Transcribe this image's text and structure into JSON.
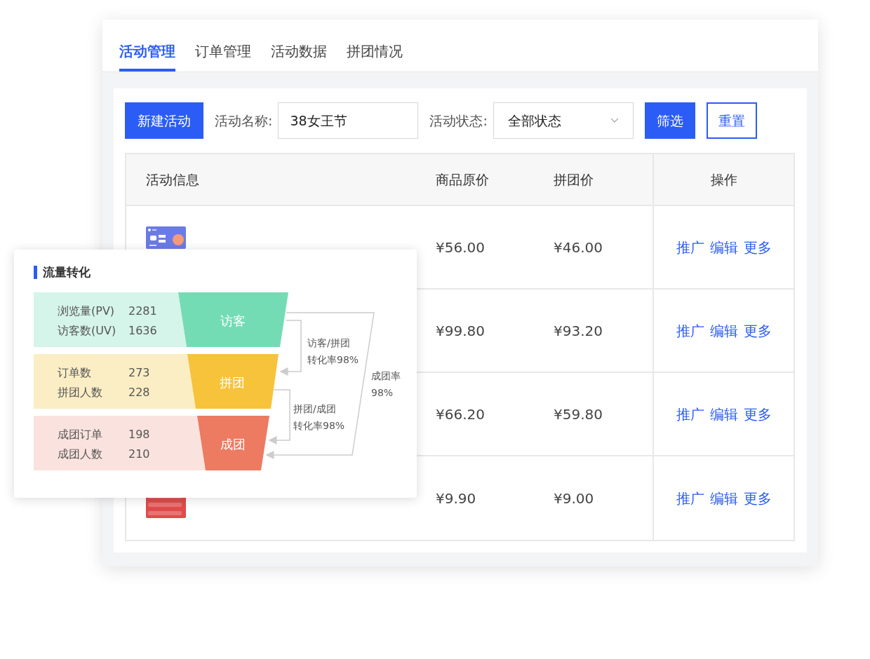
{
  "tabs": [
    {
      "label": "活动管理",
      "selected": true
    },
    {
      "label": "订单管理",
      "selected": false
    },
    {
      "label": "活动数据",
      "selected": false
    },
    {
      "label": "拼团情况",
      "selected": false
    }
  ],
  "toolbar": {
    "new_button": "新建活动",
    "name_label": "活动名称:",
    "name_value": "38女王节",
    "status_label": "活动状态:",
    "status_value": "全部状态",
    "filter_button": "筛选",
    "reset_button": "重置"
  },
  "table": {
    "columns": [
      "活动信息",
      "商品原价",
      "拼团价",
      "操作"
    ],
    "rows": [
      {
        "kind": "picture",
        "price": "¥56.00",
        "group_price": "¥46.00",
        "actions": [
          "推广",
          "编辑",
          "更多"
        ]
      },
      {
        "price": "¥99.80",
        "group_price": "¥93.20",
        "actions": [
          "推广",
          "编辑",
          "更多"
        ]
      },
      {
        "price": "¥66.20",
        "group_price": "¥59.80",
        "actions": [
          "推广",
          "编辑",
          "更多"
        ]
      },
      {
        "kind": "picture",
        "price": "¥9.90",
        "group_price": "¥9.00",
        "actions": [
          "推广",
          "编辑",
          "更多"
        ]
      }
    ]
  },
  "funnel": {
    "title": "流量转化",
    "stages": [
      {
        "label": "访客",
        "color": "#74dcb5",
        "stats": [
          {
            "name": "浏览量(PV)",
            "value": "2281"
          },
          {
            "name": "访客数(UV)",
            "value": "1636"
          }
        ]
      },
      {
        "label": "拼团",
        "color": "#f6c33a",
        "stats": [
          {
            "name": "订单数",
            "value": "273"
          },
          {
            "name": "拼团人数",
            "value": "228"
          }
        ]
      },
      {
        "label": "成团",
        "color": "#ec7b62",
        "stats": [
          {
            "name": "成团订单",
            "value": "198"
          },
          {
            "name": "成团人数",
            "value": "210"
          }
        ]
      }
    ],
    "rates": [
      [
        "访客/拼团",
        "转化率98%"
      ],
      [
        "拼团/成团",
        "转化率98%"
      ],
      [
        "成团率",
        "98%"
      ]
    ]
  }
}
